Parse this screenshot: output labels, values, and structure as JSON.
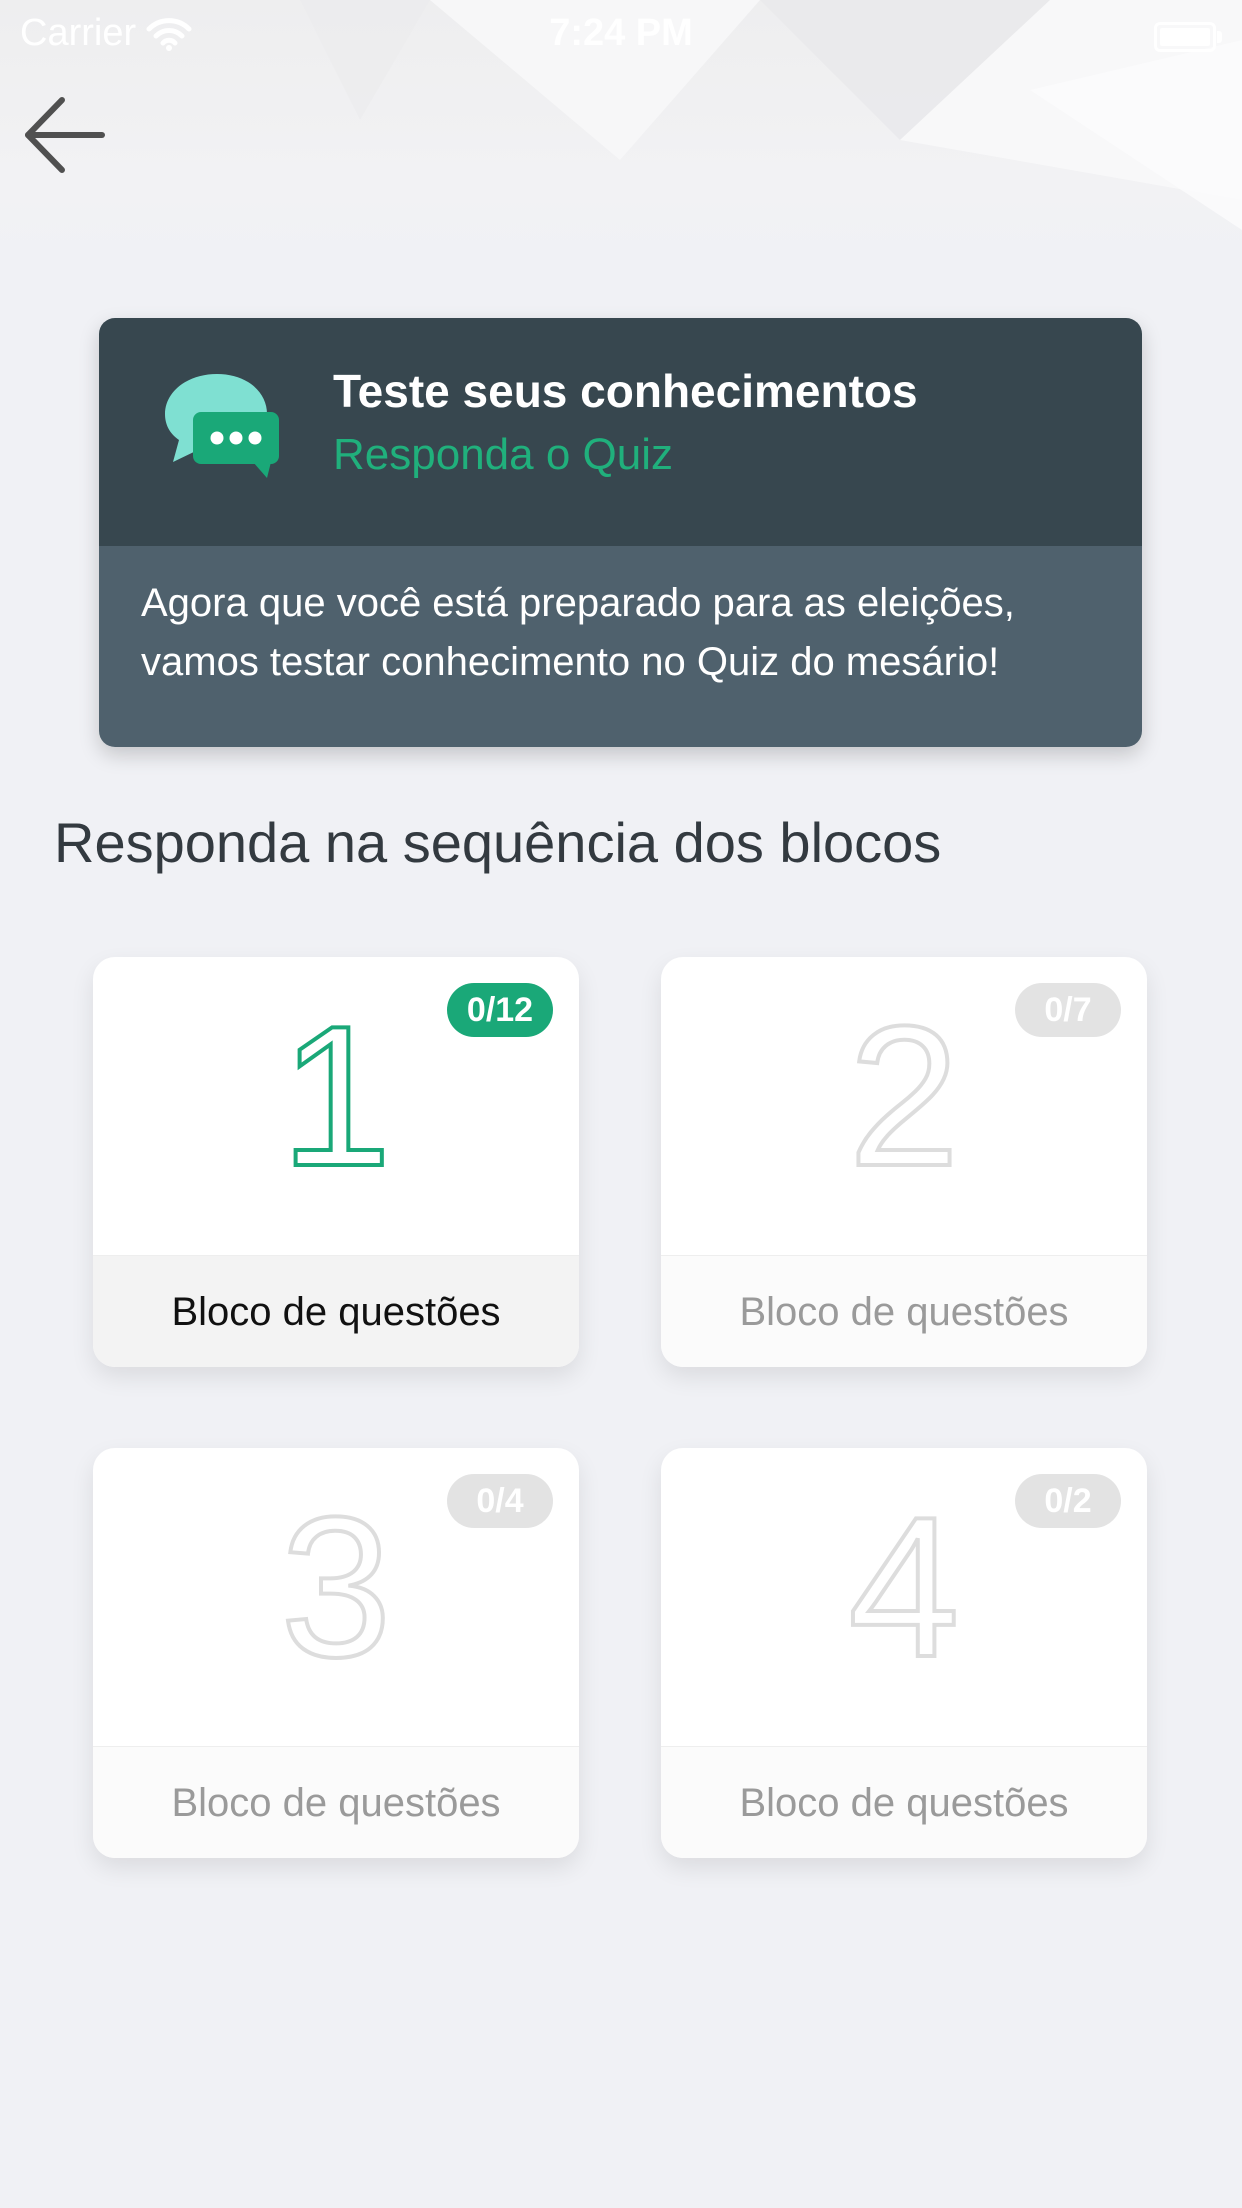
{
  "status_bar": {
    "carrier": "Carrier",
    "time": "7:24 PM",
    "wifi_icon": "wifi-icon",
    "battery_icon": "battery-icon"
  },
  "nav": {
    "back_icon": "arrow-left-icon"
  },
  "info_card": {
    "icon": "chat-bubbles-icon",
    "title": "Teste seus conhecimentos",
    "subtitle": "Responda o Quiz",
    "description": "Agora que você está preparado para as eleições, vamos testar conhecimento no Quiz do mesário!"
  },
  "section_title": "Responda na sequência dos blocos",
  "blocks": [
    {
      "number": "1",
      "progress": "0/12",
      "label": "Bloco de questões",
      "active": true
    },
    {
      "number": "2",
      "progress": "0/7",
      "label": "Bloco de questões",
      "active": false
    },
    {
      "number": "3",
      "progress": "0/4",
      "label": "Bloco de questões",
      "active": false
    },
    {
      "number": "4",
      "progress": "0/2",
      "label": "Bloco de questões",
      "active": false
    }
  ],
  "colors": {
    "accent": "#1aa878",
    "card_dark": "#37474f",
    "card_body": "#4f616d",
    "page_bg": "#f0f1f5",
    "inactive_outline": "#dddddd",
    "inactive_badge": "#e3e3e3"
  }
}
